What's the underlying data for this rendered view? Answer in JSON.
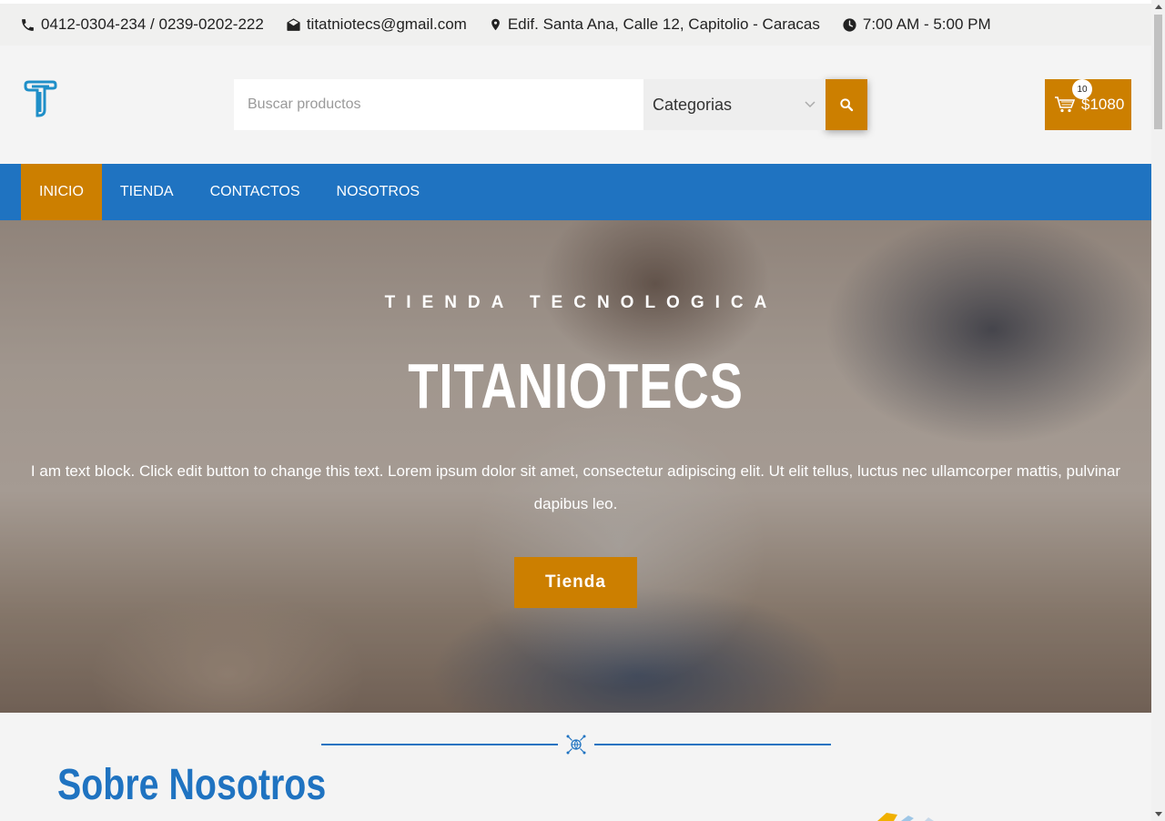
{
  "topbar": {
    "phone": "0412-0304-234 / 0239-0202-222",
    "email": "titatniotecs@gmail.com",
    "address": "Edif. Santa Ana, Calle 12, Capitolio - Caracas",
    "hours": "7:00 AM - 5:00 PM"
  },
  "header": {
    "search_placeholder": "Buscar productos",
    "category_label": "Categorias",
    "cart_count": "10",
    "cart_amount": "$1080"
  },
  "nav": {
    "items": [
      "INICIO",
      "TIENDA",
      "CONTACTOS",
      "NOSOTROS"
    ]
  },
  "hero": {
    "eyebrow": "TIENDA TECNOLOGICA",
    "title": "TITANIOTECS",
    "text": "I am text block. Click edit button to change this text. Lorem ipsum dolor sit amet, consectetur adipiscing elit. Ut elit tellus, luctus nec ullamcorper mattis, pulvinar dapibus leo.",
    "button_label": "Tienda"
  },
  "about": {
    "title": "Sobre Nosotros"
  },
  "colors": {
    "primary_blue": "#1f73c1",
    "accent_orange": "#cc7f00"
  },
  "icons": {
    "phone": "phone-icon",
    "email": "envelope-icon",
    "address": "map-pin-icon",
    "hours": "clock-icon",
    "search": "search-icon",
    "cart": "cart-icon",
    "divider": "globe-network-icon"
  }
}
